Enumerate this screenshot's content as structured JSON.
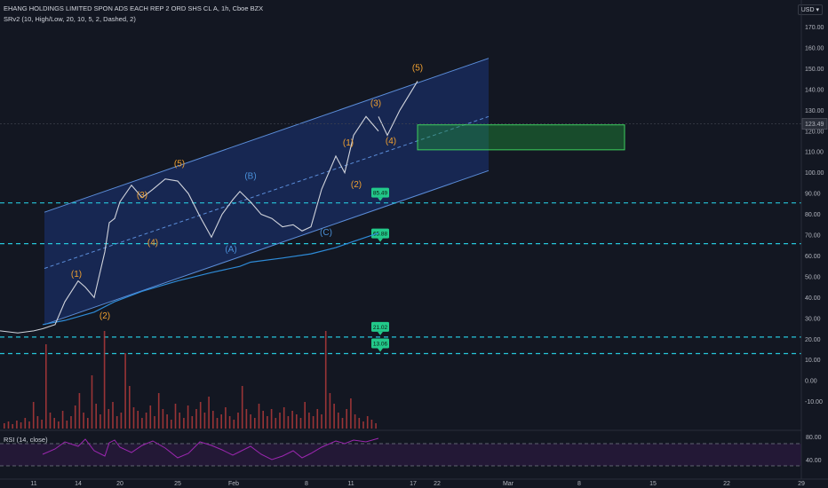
{
  "header": {
    "title": "EHANG HOLDINGS LIMITED SPON ADS EACH REP 2 ORD SHS CL A, 1h, Cboe BZX",
    "indicator": "SRv2 (10, High/Low, 20, 10, 5, 2, Dashed, 2)",
    "currency": "USD"
  },
  "rsi": {
    "label": "RSI (14, close)",
    "ticks": [
      "80.00",
      "40.00"
    ]
  },
  "colors": {
    "background": "#131722",
    "channel_fill": "#2962ff",
    "channel_line": "#5b8dd9",
    "support_resistance": "#26c6da",
    "level_label": "#22c98a",
    "target_box": "#1e8f3a",
    "wave_orange": "#f0a030",
    "wave_blue": "#4a90d9",
    "price_line": "#d1d4dc",
    "ma_line": "#2e8bd8",
    "volume_bar": "#b23a3a",
    "rsi_line": "#9c27b0",
    "current_price_badge": "#2a2e39"
  },
  "chart_data": {
    "type": "line",
    "title": "EHANG HOLDINGS LIMITED SPON ADS EACH REP 2 ORD SHS CL A, 1h, Cboe BZX",
    "x_ticks": [
      "11",
      "14",
      "20",
      "25",
      "Feb",
      "8",
      "11",
      "17",
      "22",
      "Mar",
      "8",
      "15",
      "22",
      "29"
    ],
    "y_ticks": [
      170,
      160,
      150,
      140,
      130,
      120,
      110,
      100,
      90,
      80,
      70,
      60,
      50,
      40,
      30,
      20,
      10,
      0,
      -10
    ],
    "y_tick_labels": [
      "170.00",
      "160.00",
      "150.00",
      "140.00",
      "130.00",
      "120.00",
      "110.00",
      "100.00",
      "90.00",
      "80.00",
      "70.00",
      "60.00",
      "50.00",
      "40.00",
      "30.00",
      "20.00",
      "10.00",
      "0.00",
      "-10.00"
    ],
    "ylim": [
      -15,
      178
    ],
    "current_price": 123.49,
    "current_price_label": "123.49",
    "price_series": {
      "x": [
        "11",
        "12",
        "13",
        "14",
        "15",
        "16",
        "17",
        "18",
        "19",
        "20",
        "21",
        "22",
        "23",
        "24",
        "25",
        "26",
        "27",
        "28",
        "29",
        "30",
        "31",
        "Feb",
        "2",
        "3",
        "4",
        "5",
        "6",
        "7",
        "8",
        "9",
        "10",
        "11",
        "12",
        "13"
      ],
      "y": [
        25,
        27,
        38,
        48,
        45,
        40,
        62,
        76,
        78,
        86,
        94,
        88,
        92,
        97,
        96,
        90,
        79,
        69,
        80,
        87,
        91,
        86,
        80,
        78,
        74,
        75,
        72,
        74,
        92,
        108,
        100,
        118,
        127,
        120
      ]
    },
    "moving_average": {
      "x": [
        "11",
        "13",
        "16",
        "19",
        "22",
        "25",
        "28",
        "31",
        "Feb",
        "4",
        "7",
        "9",
        "11",
        "13"
      ],
      "y": [
        27,
        29,
        33,
        38,
        43,
        48,
        52,
        55,
        57,
        59,
        61,
        64,
        67,
        71
      ]
    },
    "projection": {
      "x": [
        "13",
        "14",
        "15",
        "16"
      ],
      "y": [
        127,
        118,
        130,
        144
      ]
    },
    "channel": {
      "lower": {
        "x": [
          "11",
          "17"
        ],
        "y": [
          27,
          101
        ]
      },
      "upper": {
        "x": [
          "11",
          "17"
        ],
        "y": [
          81,
          155
        ]
      },
      "mid": {
        "x": [
          "11",
          "17"
        ],
        "y": [
          54,
          127
        ]
      }
    },
    "target_zone": {
      "x": [
        "16",
        "24"
      ],
      "y": [
        111,
        123
      ]
    },
    "levels": [
      {
        "value": 85.49,
        "label": "85.49"
      },
      {
        "value": 65.88,
        "label": "65.88"
      },
      {
        "value": 21.02,
        "label": "21.02"
      },
      {
        "value": 13.06,
        "label": "13.06"
      }
    ],
    "wave_labels": [
      {
        "text": "(1)",
        "x": "12",
        "y": 50,
        "color": "orange"
      },
      {
        "text": "(2)",
        "x": "14",
        "y": 30,
        "color": "orange"
      },
      {
        "text": "(3)",
        "x": "20",
        "y": 88,
        "color": "orange"
      },
      {
        "text": "(4)",
        "x": "20",
        "y": 65,
        "color": "orange"
      },
      {
        "text": "(5)",
        "x": "25",
        "y": 103,
        "color": "orange"
      },
      {
        "text": "(A)",
        "x": "31",
        "y": 62,
        "color": "blue"
      },
      {
        "text": "(B)",
        "x": "Feb",
        "y": 97,
        "color": "blue"
      },
      {
        "text": "(C)",
        "x": "8",
        "y": 70,
        "color": "blue"
      },
      {
        "text": "(1)",
        "x": "10",
        "y": 113,
        "color": "orange"
      },
      {
        "text": "(2)",
        "x": "11",
        "y": 93,
        "color": "orange"
      },
      {
        "text": "(3)",
        "x": "12",
        "y": 132,
        "color": "orange"
      },
      {
        "text": "(4)",
        "x": "13",
        "y": 114,
        "color": "orange"
      },
      {
        "text": "(5)",
        "x": "16",
        "y": 149,
        "color": "orange"
      }
    ],
    "legend": "none",
    "grid": false
  }
}
